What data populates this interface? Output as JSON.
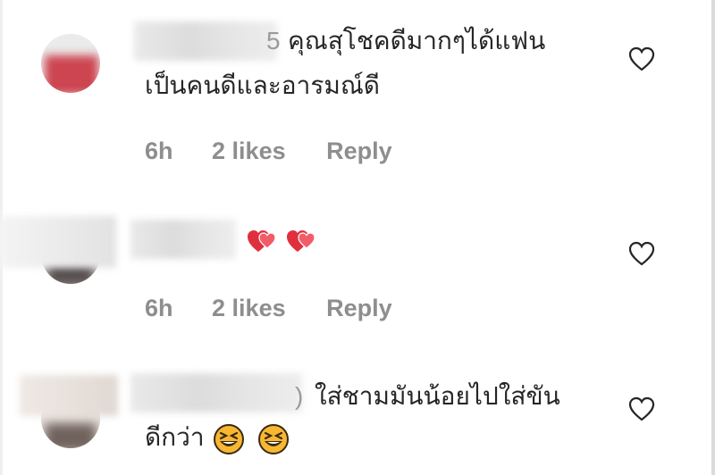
{
  "comments": [
    {
      "text_line1": "คุณสุโชคดีมากๆได้แฟน",
      "text_line2": "เป็นคนดีและอารมณ์ดี",
      "time": "6h",
      "likes": "2 likes",
      "reply": "Reply",
      "username_tail": "5"
    },
    {
      "text_line1": "",
      "time": "6h",
      "likes": "2 likes",
      "reply": "Reply",
      "emoji_icons": [
        "two-hearts-icon",
        "two-hearts-icon"
      ]
    },
    {
      "text_line1": "ใส่ชามมันน้อยไปใส่ขัน",
      "text_line2": "ดีกว่า",
      "username_tail": ")",
      "emoji_icons": [
        "grinning-squinting-face-icon",
        "grinning-squinting-face-icon"
      ]
    }
  ],
  "colors": {
    "text": "#262626",
    "meta": "#8e8e8e",
    "heart_red": "#e0303e",
    "emoji_yellow": "#f7b733"
  }
}
